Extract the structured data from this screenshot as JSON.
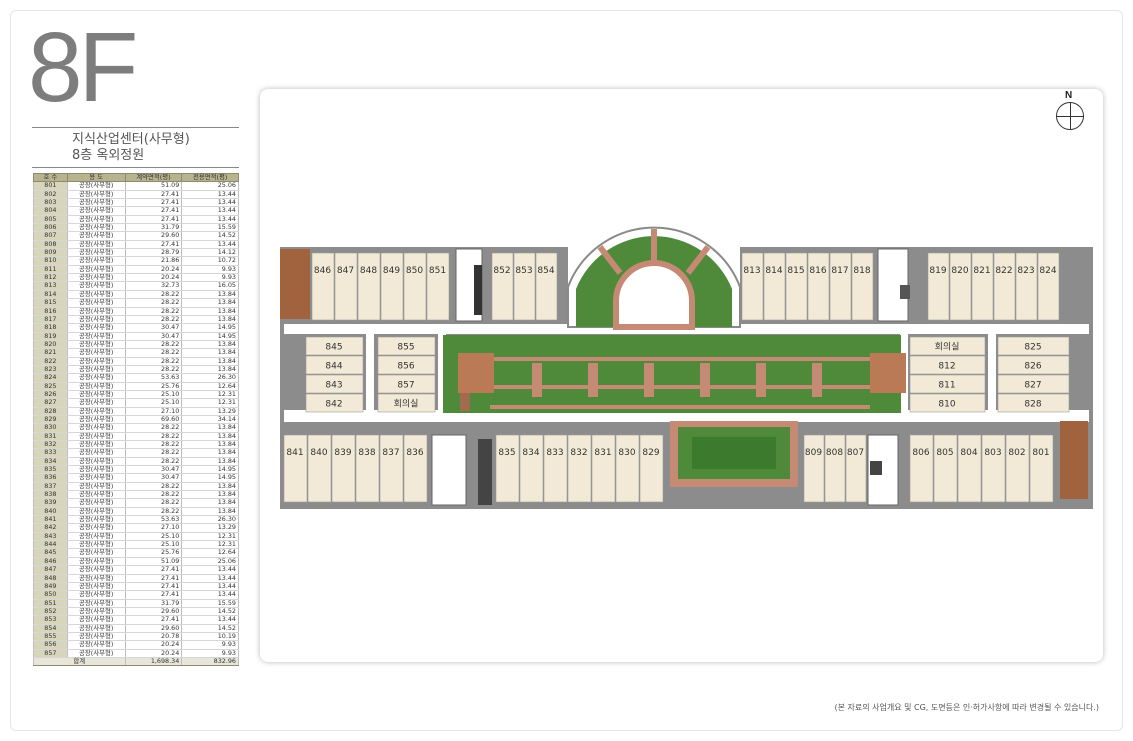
{
  "floor": "8F",
  "subtitle_line1": "지식산업센터(사무형)",
  "subtitle_line2": "8층 옥외정원",
  "table": {
    "headers": [
      "호 수",
      "용 도",
      "계약면적(평)",
      "전용면적(평)"
    ],
    "rows": [
      [
        "801",
        "공장(사무형)",
        "51.09",
        "25.06"
      ],
      [
        "802",
        "공장(사무형)",
        "27.41",
        "13.44"
      ],
      [
        "803",
        "공장(사무형)",
        "27.41",
        "13.44"
      ],
      [
        "804",
        "공장(사무형)",
        "27.41",
        "13.44"
      ],
      [
        "805",
        "공장(사무형)",
        "27.41",
        "13.44"
      ],
      [
        "806",
        "공장(사무형)",
        "31.79",
        "15.59"
      ],
      [
        "807",
        "공장(사무형)",
        "29.60",
        "14.52"
      ],
      [
        "808",
        "공장(사무형)",
        "27.41",
        "13.44"
      ],
      [
        "809",
        "공장(사무형)",
        "28.79",
        "14.12"
      ],
      [
        "810",
        "공장(사무형)",
        "21.86",
        "10.72"
      ],
      [
        "811",
        "공장(사무형)",
        "20.24",
        "9.93"
      ],
      [
        "812",
        "공장(사무형)",
        "20.24",
        "9.93"
      ],
      [
        "813",
        "공장(사무형)",
        "32.73",
        "16.05"
      ],
      [
        "814",
        "공장(사무형)",
        "28.22",
        "13.84"
      ],
      [
        "815",
        "공장(사무형)",
        "28.22",
        "13.84"
      ],
      [
        "816",
        "공장(사무형)",
        "28.22",
        "13.84"
      ],
      [
        "817",
        "공장(사무형)",
        "28.22",
        "13.84"
      ],
      [
        "818",
        "공장(사무형)",
        "30.47",
        "14.95"
      ],
      [
        "819",
        "공장(사무형)",
        "30.47",
        "14.95"
      ],
      [
        "820",
        "공장(사무형)",
        "28.22",
        "13.84"
      ],
      [
        "821",
        "공장(사무형)",
        "28.22",
        "13.84"
      ],
      [
        "822",
        "공장(사무형)",
        "28.22",
        "13.84"
      ],
      [
        "823",
        "공장(사무형)",
        "28.22",
        "13.84"
      ],
      [
        "824",
        "공장(사무형)",
        "53.63",
        "26.30"
      ],
      [
        "825",
        "공장(사무형)",
        "25.76",
        "12.64"
      ],
      [
        "826",
        "공장(사무형)",
        "25.10",
        "12.31"
      ],
      [
        "827",
        "공장(사무형)",
        "25.10",
        "12.31"
      ],
      [
        "828",
        "공장(사무형)",
        "27.10",
        "13.29"
      ],
      [
        "829",
        "공장(사무형)",
        "69.60",
        "34.14"
      ],
      [
        "830",
        "공장(사무형)",
        "28.22",
        "13.84"
      ],
      [
        "831",
        "공장(사무형)",
        "28.22",
        "13.84"
      ],
      [
        "832",
        "공장(사무형)",
        "28.22",
        "13.84"
      ],
      [
        "833",
        "공장(사무형)",
        "28.22",
        "13.84"
      ],
      [
        "834",
        "공장(사무형)",
        "28.22",
        "13.84"
      ],
      [
        "835",
        "공장(사무형)",
        "30.47",
        "14.95"
      ],
      [
        "836",
        "공장(사무형)",
        "30.47",
        "14.95"
      ],
      [
        "837",
        "공장(사무형)",
        "28.22",
        "13.84"
      ],
      [
        "838",
        "공장(사무형)",
        "28.22",
        "13.84"
      ],
      [
        "839",
        "공장(사무형)",
        "28.22",
        "13.84"
      ],
      [
        "840",
        "공장(사무형)",
        "28.22",
        "13.84"
      ],
      [
        "841",
        "공장(사무형)",
        "53.63",
        "26.30"
      ],
      [
        "842",
        "공장(사무형)",
        "27.10",
        "13.29"
      ],
      [
        "843",
        "공장(사무형)",
        "25.10",
        "12.31"
      ],
      [
        "844",
        "공장(사무형)",
        "25.10",
        "12.31"
      ],
      [
        "845",
        "공장(사무형)",
        "25.76",
        "12.64"
      ],
      [
        "846",
        "공장(사무형)",
        "51.09",
        "25.06"
      ],
      [
        "847",
        "공장(사무형)",
        "27.41",
        "13.44"
      ],
      [
        "848",
        "공장(사무형)",
        "27.41",
        "13.44"
      ],
      [
        "849",
        "공장(사무형)",
        "27.41",
        "13.44"
      ],
      [
        "850",
        "공장(사무형)",
        "27.41",
        "13.44"
      ],
      [
        "851",
        "공장(사무형)",
        "31.79",
        "15.59"
      ],
      [
        "852",
        "공장(사무형)",
        "29.60",
        "14.52"
      ],
      [
        "853",
        "공장(사무형)",
        "27.41",
        "13.44"
      ],
      [
        "854",
        "공장(사무형)",
        "29.60",
        "14.52"
      ],
      [
        "855",
        "공장(사무형)",
        "20.78",
        "10.19"
      ],
      [
        "856",
        "공장(사무형)",
        "20.24",
        "9.93"
      ],
      [
        "857",
        "공장(사무형)",
        "20.24",
        "9.93"
      ]
    ],
    "total": [
      "합계",
      "1,698.34",
      "832.96"
    ]
  },
  "plan": {
    "compass": "N",
    "top_left_units": [
      "846",
      "847",
      "848",
      "849",
      "850",
      "851"
    ],
    "top_mid_units": [
      "852",
      "853",
      "854"
    ],
    "top_right_a_units": [
      "813",
      "814",
      "815",
      "816",
      "817",
      "818"
    ],
    "top_right_b_units": [
      "819",
      "820",
      "821",
      "822",
      "823",
      "824"
    ],
    "left_wing_a": [
      "845",
      "844",
      "843",
      "842"
    ],
    "left_wing_b": [
      "855",
      "856",
      "857",
      "회의실"
    ],
    "right_wing_a": [
      "회의실",
      "812",
      "811",
      "810"
    ],
    "right_wing_b": [
      "825",
      "826",
      "827",
      "828"
    ],
    "bottom_left_units": [
      "841",
      "840",
      "839",
      "838",
      "837",
      "836"
    ],
    "bottom_mid_units": [
      "835",
      "834",
      "833",
      "832",
      "831",
      "830",
      "829"
    ],
    "bottom_center_units": [
      "809",
      "808",
      "807"
    ],
    "bottom_right_units": [
      "806",
      "805",
      "804",
      "803",
      "802",
      "801"
    ]
  },
  "disclaimer": "(본 자료의 사업개요 및 CG, 도면등은 인·허가사항에 따라 변경될 수 있습니다.)",
  "colors": {
    "unit_fill": "#f2ead7",
    "garden": "#4f8a3a",
    "path": "#c48a73",
    "wall": "#8a8a8a",
    "corridor": "#ffffff",
    "table_header": "#b8b38f"
  }
}
